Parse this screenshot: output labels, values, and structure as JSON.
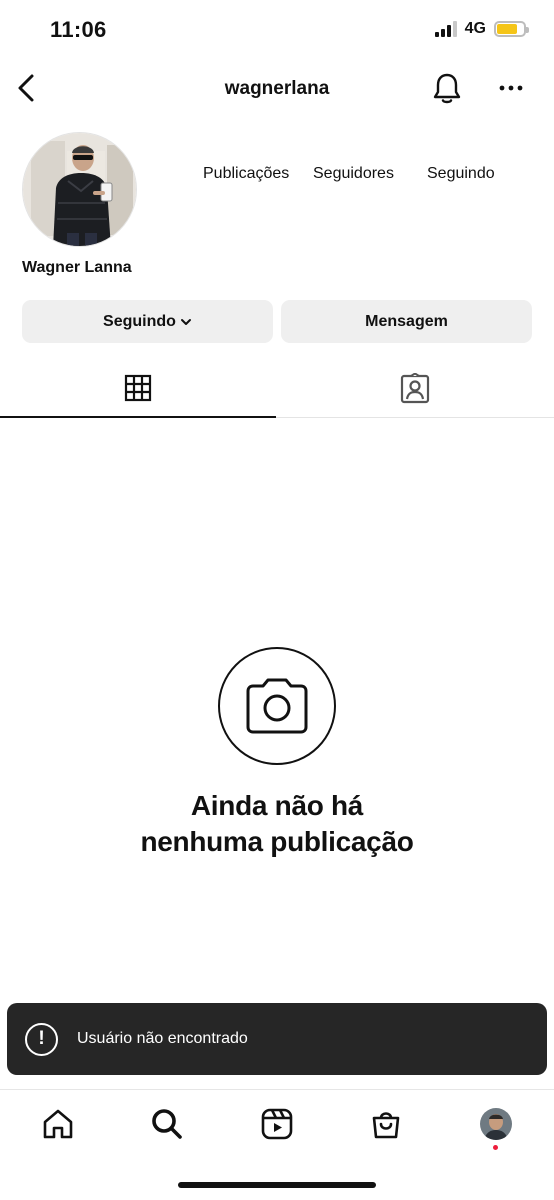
{
  "status_bar": {
    "time": "11:06",
    "network": "4G",
    "signal_bars": 3,
    "signal_total": 4,
    "battery_color": "#f5c518"
  },
  "header": {
    "username": "wagnerlana",
    "icons": [
      "chevron-left-icon",
      "bell-icon",
      "more-horizontal-icon"
    ]
  },
  "profile": {
    "display_name": "Wagner Lanna",
    "stats": {
      "posts_label": "Publicações",
      "followers_label": "Seguidores",
      "following_label": "Seguindo"
    }
  },
  "actions": {
    "following_label": "Seguindo",
    "message_label": "Mensagem"
  },
  "tabs": [
    {
      "icon": "grid-icon",
      "active": true
    },
    {
      "icon": "tagged-person-icon",
      "active": false
    }
  ],
  "empty_state": {
    "line1": "Ainda não há",
    "line2": "nenhuma publicação",
    "icon": "camera-icon"
  },
  "toast": {
    "icon": "exclamation-circle-icon",
    "message": "Usuário não encontrado"
  },
  "bottom_nav": {
    "items": [
      "home-icon",
      "search-icon",
      "reels-icon",
      "shop-bag-icon",
      "profile-avatar"
    ],
    "notification_dot_color": "#ed1d3c"
  },
  "colors": {
    "button_bg": "#efefef",
    "toast_bg": "#262626",
    "text": "#111111"
  }
}
